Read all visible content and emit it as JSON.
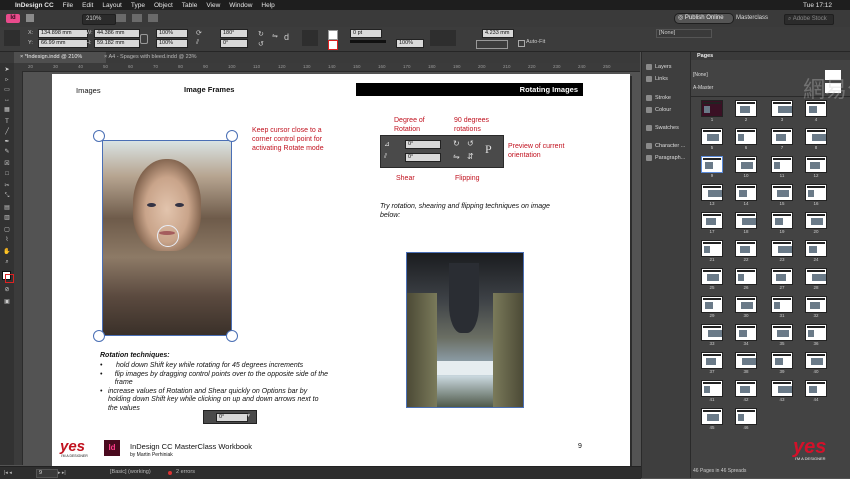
{
  "menubar": {
    "apple": "",
    "app_name": "InDesign CC",
    "items": [
      "File",
      "Edit",
      "Layout",
      "Type",
      "Object",
      "Table",
      "View",
      "Window",
      "Help"
    ],
    "clock": "Tue 17:12"
  },
  "appbar": {
    "zoom": "210%",
    "publish_online": "Publish Online",
    "workspace": "Masterclass",
    "search_placeholder": "Adobe Stock"
  },
  "control": {
    "x": "134.898 mm",
    "y": "66.99 mm",
    "w": "44.386 mm",
    "h": "59.182 mm",
    "scale_x": "100%",
    "scale_y": "100%",
    "rotate": "180°",
    "shear": "0°",
    "stroke": "0 pt",
    "percent": "100%",
    "size": "4.233 mm",
    "frame_label": "[None]",
    "auto_fit": "Auto-Fit"
  },
  "tabs": [
    {
      "label": "*Indesign.indd @ 210%",
      "active": true
    },
    {
      "label": "A4 - Spages with bleed.indd @ 23%",
      "active": false
    }
  ],
  "ruler_marks": [
    "20",
    "30",
    "40",
    "50",
    "60",
    "70",
    "80",
    "90",
    "100",
    "110",
    "120",
    "130",
    "140",
    "150",
    "160",
    "170",
    "180",
    "190",
    "200",
    "210",
    "220",
    "230",
    "240",
    "250"
  ],
  "page": {
    "header_left": "Images",
    "header_center": "Image Frames",
    "header_right": "Rotating Images",
    "callout_cursor": "Keep cursor close to a corner control point for activating Rotate mode",
    "label_degree": "Degree of Rotation",
    "label_90": "90 degrees rotations",
    "label_preview": "Preview of current orientation",
    "label_shear": "Shear",
    "label_flipping": "Flipping",
    "panel_value_1": "0°",
    "panel_value_2": "0°",
    "try_text": "Try rotation, shearing and flipping techniques on image below:",
    "techniques_title": "Rotation techniques:",
    "techniques": [
      "hold down Shift key while rotating for 45 degrees increments",
      "flip images by dragging control points over to the opposite side of the frame",
      "increase values of Rotation and Shear quickly on Options bar by holding down Shift key while clicking on up and down arrows next to the values"
    ],
    "inline_value": "0°",
    "logo_text": "yes",
    "logo_sub": "I'M A DESIGNER",
    "id_badge": "Id",
    "footer_title": "InDesign CC MasterClass Workbook",
    "footer_author": "by Martin Perhiniak",
    "page_number": "9"
  },
  "panel_strip": {
    "items": [
      "Layers",
      "Links",
      "Stroke",
      "Colour",
      "Swatches",
      "Character ...",
      "Paragraph..."
    ]
  },
  "pages_panel": {
    "title": "Pages",
    "none_label": "[None]",
    "master_label": "A-Master",
    "page_numbers": [
      "1",
      "2",
      "3",
      "4",
      "5",
      "6",
      "7",
      "8",
      "9",
      "10",
      "11",
      "12",
      "13",
      "14",
      "15",
      "16",
      "17",
      "18",
      "19",
      "20",
      "21",
      "22",
      "23",
      "24",
      "25",
      "26",
      "27",
      "28",
      "29",
      "30",
      "31",
      "32",
      "33",
      "34",
      "35",
      "36",
      "37",
      "38",
      "39",
      "40",
      "41",
      "42",
      "43",
      "44",
      "45",
      "46"
    ],
    "footer": "46 Pages in 46 Spreads"
  },
  "watermark": "網易公开",
  "corner_logo": {
    "text": "yes",
    "sub": "I'M A DESIGNER"
  },
  "status": {
    "page": "9",
    "style": "[Basic] (working)",
    "errors": "2 errors"
  }
}
